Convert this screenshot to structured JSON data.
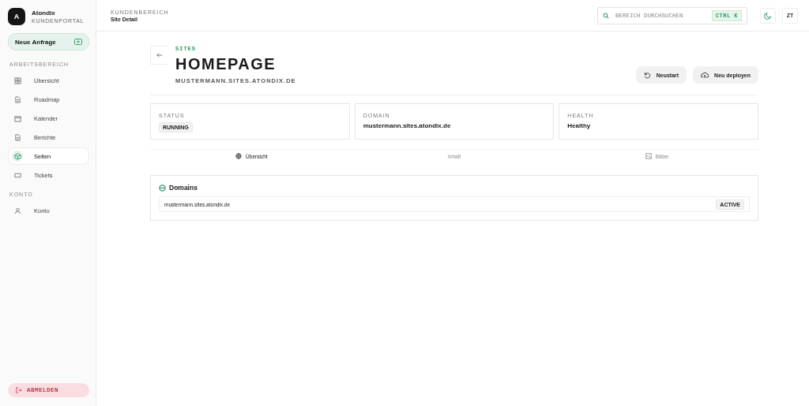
{
  "brand": {
    "name": "Atondix",
    "subtitle": "KUNDENPORTAL",
    "logo": "A"
  },
  "new_request": "Neue Anfrage",
  "nav_sections": [
    {
      "title": "ARBEITSBEREICH",
      "items": [
        {
          "label": "Übersicht",
          "kind": "grid",
          "selected": false
        },
        {
          "label": "Roadmap",
          "kind": "doc",
          "selected": false
        },
        {
          "label": "Kalender",
          "kind": "calendar",
          "selected": false
        },
        {
          "label": "Berichte",
          "kind": "doc",
          "selected": false
        },
        {
          "label": "Seiten",
          "kind": "cube",
          "selected": true
        },
        {
          "label": "Tickets",
          "kind": "ticket",
          "selected": false
        }
      ]
    },
    {
      "title": "KONTO",
      "items": [
        {
          "label": "Konto",
          "kind": "user",
          "selected": false
        }
      ]
    }
  ],
  "logout": "ABMELDEN",
  "header": {
    "eyebrow": "KUNDENBEREICH",
    "title": "Site Detail",
    "search_placeholder": "BEREICH DURCHSUCHEN",
    "shortcut": "CTRL K",
    "avatar": "ZT"
  },
  "page": {
    "eyebrow": "SITES",
    "title": "HOMEPAGE",
    "subtitle": "MUSTERMANN.SITES.ATONDIX.DE",
    "actions": [
      {
        "label": "Neustart",
        "kind": "restart"
      },
      {
        "label": "Neu deployen",
        "kind": "deploy"
      }
    ]
  },
  "stats": [
    {
      "label": "STATUS",
      "value": "RUNNING",
      "kind": "badge"
    },
    {
      "label": "DOMAIN",
      "value": "mustermann.sites.atondix.de",
      "kind": "text"
    },
    {
      "label": "HEALTH",
      "value": "Healthy",
      "kind": "text"
    }
  ],
  "tabs": [
    {
      "label": "Übersicht",
      "kind": "globe",
      "selected": true
    },
    {
      "label": "Inhalt",
      "kind": "none",
      "selected": false
    },
    {
      "label": "Bilder",
      "kind": "image",
      "selected": false
    }
  ],
  "domains": {
    "title": "Domains",
    "rows": [
      {
        "domain": "mustermann.sites.atondix.de",
        "status": "ACTIVE"
      }
    ]
  }
}
